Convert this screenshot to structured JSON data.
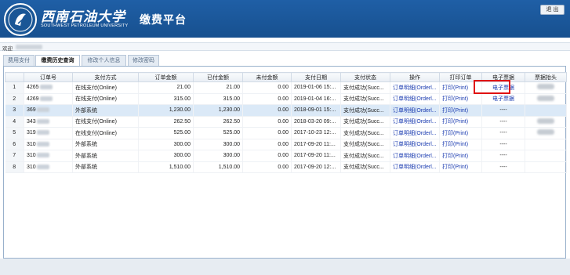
{
  "header": {
    "university_cn": "西南石油大学",
    "university_en": "SOUTHWEST PETROLEUM UNIVERSITY",
    "app_title": "缴费平台",
    "exit_label": "退 出",
    "logo_icon": "university-seal-icon",
    "background_color": "#1f5fa6"
  },
  "welcome": {
    "label": "欢迎"
  },
  "tabs": [
    {
      "label": "费用支付",
      "active": false
    },
    {
      "label": "缴费历史查询",
      "active": true
    },
    {
      "label": "修改个人信息",
      "active": false
    },
    {
      "label": "修改密码",
      "active": false
    }
  ],
  "table": {
    "columns": [
      "",
      "订单号",
      "支付方式",
      "订单金额",
      "已付金额",
      "未付金额",
      "支付日期",
      "支付状态",
      "操作",
      "打印订单",
      "电子票据",
      "票据抬头"
    ],
    "rows": [
      {
        "n": "1",
        "order": "4265",
        "method": "在线支付(Online)",
        "amount": "21.00",
        "paid": "21.00",
        "unpaid": "0.00",
        "date": "2019-01-06 15:...",
        "status": "支付成功(Succ...",
        "op": "订单明细(Orderl...",
        "print": "打印(Print)",
        "receipt": "电子票据",
        "title_blur": true
      },
      {
        "n": "2",
        "order": "4269",
        "method": "在线支付(Online)",
        "amount": "315.00",
        "paid": "315.00",
        "unpaid": "0.00",
        "date": "2019-01-04 16:...",
        "status": "支付成功(Succ...",
        "op": "订单明细(Orderl...",
        "print": "打印(Print)",
        "receipt": "电子票据",
        "title_blur": true
      },
      {
        "n": "3",
        "order": "369",
        "method": "外部系统",
        "amount": "1,230.00",
        "paid": "1,230.00",
        "unpaid": "0.00",
        "date": "2018-09-01 15:...",
        "status": "支付成功(Succ...",
        "op": "订单明细(Orderl...",
        "print": "打印(Print)",
        "receipt": "----",
        "title_blur": false
      },
      {
        "n": "4",
        "order": "343",
        "method": "在线支付(Online)",
        "amount": "262.50",
        "paid": "262.50",
        "unpaid": "0.00",
        "date": "2018-03-20 09:...",
        "status": "支付成功(Succ...",
        "op": "订单明细(Orderl...",
        "print": "打印(Print)",
        "receipt": "----",
        "title_blur": true
      },
      {
        "n": "5",
        "order": "319",
        "method": "在线支付(Online)",
        "amount": "525.00",
        "paid": "525.00",
        "unpaid": "0.00",
        "date": "2017-10-23 12:...",
        "status": "支付成功(Succ...",
        "op": "订单明细(Orderl...",
        "print": "打印(Print)",
        "receipt": "----",
        "title_blur": true
      },
      {
        "n": "6",
        "order": "310",
        "method": "外部系统",
        "amount": "300.00",
        "paid": "300.00",
        "unpaid": "0.00",
        "date": "2017-09-20 11:...",
        "status": "支付成功(Succ...",
        "op": "订单明细(Orderl...",
        "print": "打印(Print)",
        "receipt": "----",
        "title_blur": false
      },
      {
        "n": "7",
        "order": "310",
        "method": "外部系统",
        "amount": "300.00",
        "paid": "300.00",
        "unpaid": "0.00",
        "date": "2017-09-20 11:...",
        "status": "支付成功(Succ...",
        "op": "订单明细(Orderl...",
        "print": "打印(Print)",
        "receipt": "----",
        "title_blur": false
      },
      {
        "n": "8",
        "order": "310",
        "method": "外部系统",
        "amount": "1,510.00",
        "paid": "1,510.00",
        "unpaid": "0.00",
        "date": "2017-09-20 12:...",
        "status": "支付成功(Succ...",
        "op": "订单明细(Orderl...",
        "print": "打印(Print)",
        "receipt": "----",
        "title_blur": false
      }
    ],
    "selected_row": 3,
    "highlighted_cell": {
      "row": 1,
      "column": "电子票据",
      "color": "#e01212"
    }
  }
}
